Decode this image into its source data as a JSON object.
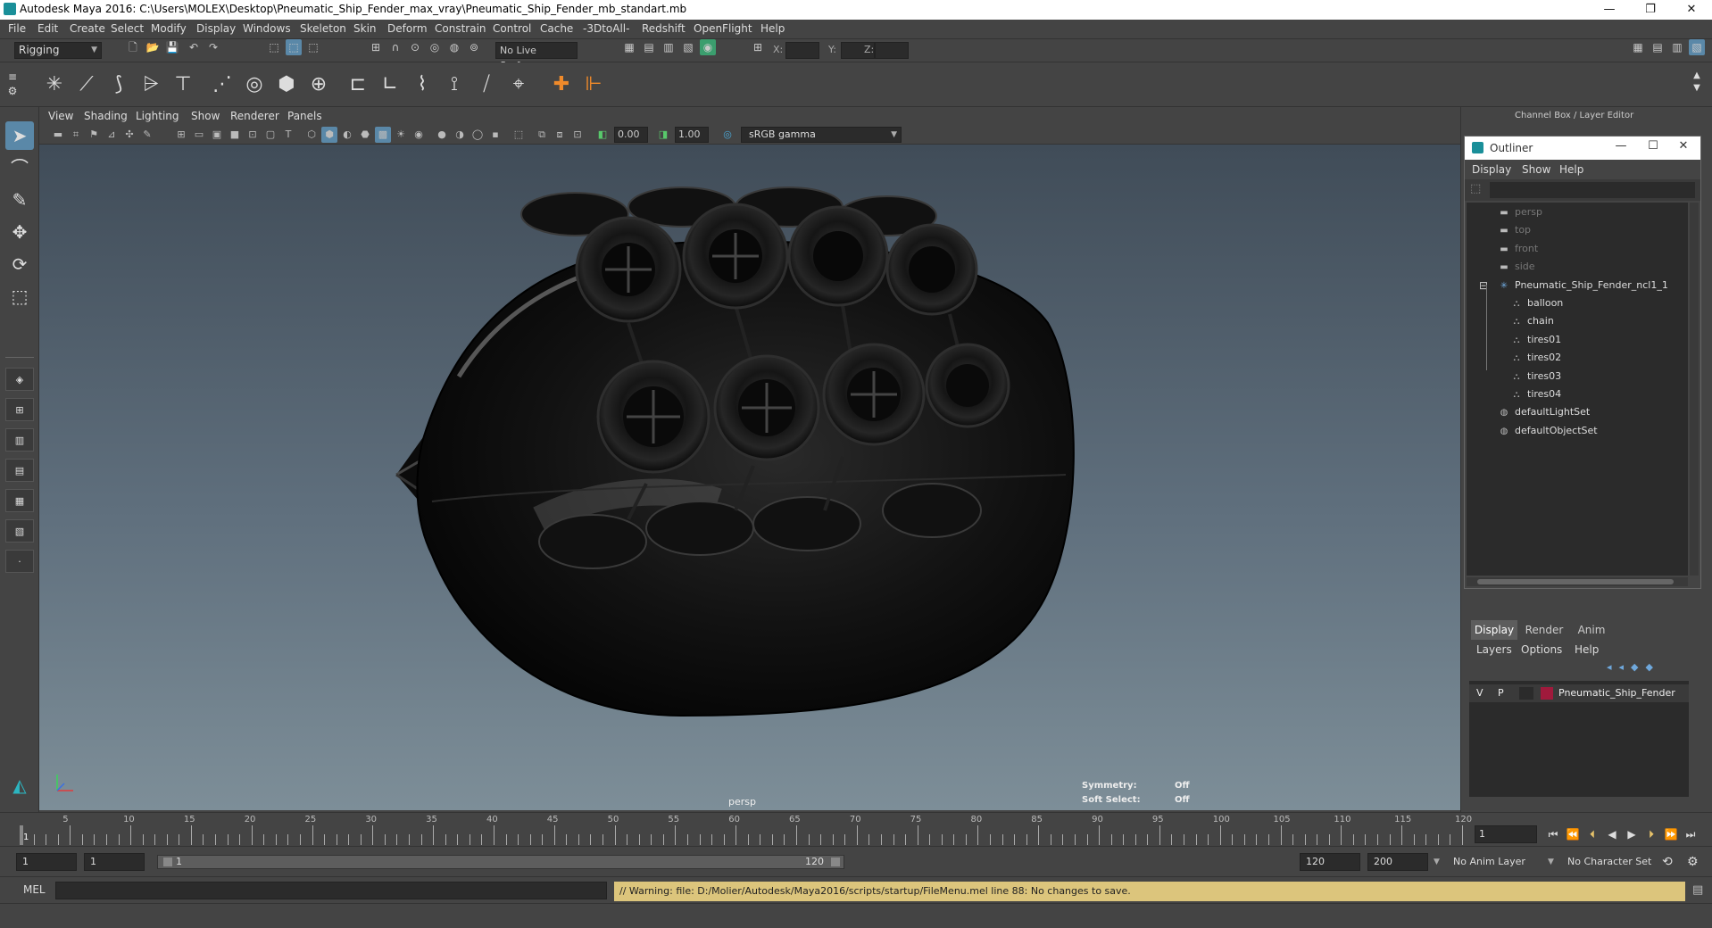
{
  "window": {
    "title": "Autodesk Maya 2016: C:\\Users\\MOLEX\\Desktop\\Pneumatic_Ship_Fender_max_vray\\Pneumatic_Ship_Fender_mb_standart.mb",
    "minimize": "—",
    "restore": "❐",
    "close": "✕"
  },
  "menubar": [
    "File",
    "Edit",
    "Create",
    "Select",
    "Modify",
    "Display",
    "Windows",
    "Skeleton",
    "Skin",
    "Deform",
    "Constrain",
    "Control",
    "Cache",
    "-3DtoAll-",
    "Redshift",
    "OpenFlight",
    "Help"
  ],
  "status": {
    "mode": "Rigging",
    "live_surface": "No Live Surface",
    "x_label": "X:",
    "y_label": "Y:",
    "z_label": "Z:"
  },
  "panel_menu": [
    "View",
    "Shading",
    "Lighting",
    "Show",
    "Renderer",
    "Panels"
  ],
  "panel_toolbar": {
    "exposure": "0.00",
    "gamma_value": "1.00",
    "color_space": "sRGB gamma"
  },
  "viewport": {
    "camera": "persp",
    "symmetry_label": "Symmetry:",
    "symmetry_value": "Off",
    "soft_select_label": "Soft Select:",
    "soft_select_value": "Off"
  },
  "channel_box": {
    "title": "Channel Box / Layer Editor"
  },
  "outliner": {
    "title": "Outliner",
    "menu": [
      "Display",
      "Show",
      "Help"
    ],
    "items": [
      {
        "label": "persp",
        "icon": "camera-icon",
        "depth": 0,
        "dim": true
      },
      {
        "label": "top",
        "icon": "camera-icon",
        "depth": 0,
        "dim": true
      },
      {
        "label": "front",
        "icon": "camera-icon",
        "depth": 0,
        "dim": true
      },
      {
        "label": "side",
        "icon": "camera-icon",
        "depth": 0,
        "dim": true
      },
      {
        "label": "Pneumatic_Ship_Fender_ncl1_1",
        "icon": "group-icon",
        "depth": 0,
        "dim": false,
        "expander": "⊟"
      },
      {
        "label": "balloon",
        "icon": "mesh-icon",
        "depth": 1,
        "dim": false
      },
      {
        "label": "chain",
        "icon": "mesh-icon",
        "depth": 1,
        "dim": false
      },
      {
        "label": "tires01",
        "icon": "mesh-icon",
        "depth": 1,
        "dim": false
      },
      {
        "label": "tires02",
        "icon": "mesh-icon",
        "depth": 1,
        "dim": false
      },
      {
        "label": "tires03",
        "icon": "mesh-icon",
        "depth": 1,
        "dim": false
      },
      {
        "label": "tires04",
        "icon": "mesh-icon",
        "depth": 1,
        "dim": false
      },
      {
        "label": "defaultLightSet",
        "icon": "set-icon",
        "depth": 0,
        "dim": false
      },
      {
        "label": "defaultObjectSet",
        "icon": "set-icon",
        "depth": 0,
        "dim": false
      }
    ]
  },
  "layer_editor": {
    "tabs": [
      "Display",
      "Render",
      "Anim"
    ],
    "menu": [
      "Layers",
      "Options",
      "Help"
    ],
    "layer": {
      "v": "V",
      "p": "P",
      "name": "Pneumatic_Ship_Fender",
      "color": "#a01a3c"
    }
  },
  "timeline": {
    "ticks": [
      5,
      10,
      15,
      20,
      25,
      30,
      35,
      40,
      45,
      50,
      55,
      60,
      65,
      70,
      75,
      80,
      85,
      90,
      95,
      100,
      105,
      110,
      115,
      120
    ],
    "start_marker": "1",
    "current_frame": "1"
  },
  "range": {
    "start": "1",
    "anim_start": "1",
    "range_start": "1",
    "range_end": "120",
    "anim_end": "120",
    "end": "200",
    "anim_layer": "No Anim Layer",
    "char_set": "No Character Set"
  },
  "command": {
    "label": "MEL",
    "warning": "// Warning: file: D:/Molier/Autodesk/Maya2016/scripts/startup/FileMenu.mel line 88: No changes to save."
  }
}
